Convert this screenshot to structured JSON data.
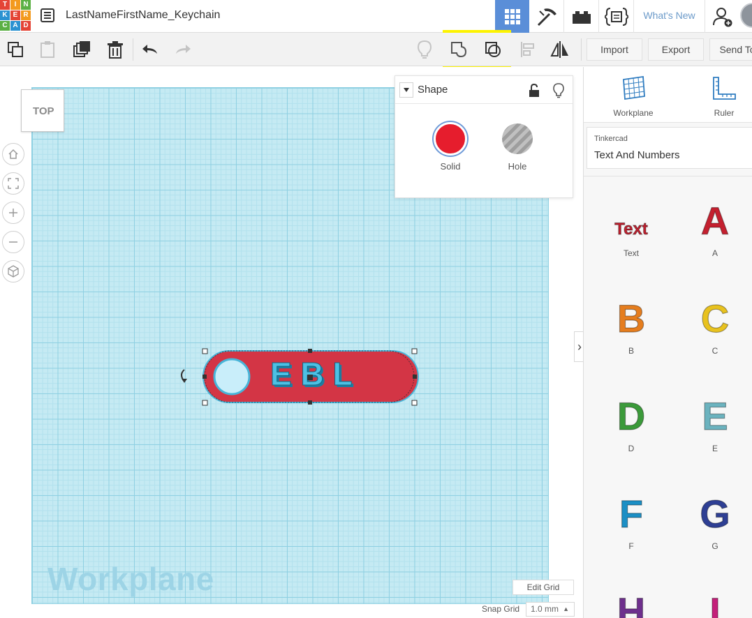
{
  "app": {
    "document_title": "LastNameFirstName_Keychain"
  },
  "logo": {
    "letters": [
      "T",
      "I",
      "N",
      "K",
      "E",
      "R",
      "C",
      "A",
      "D"
    ],
    "colors": [
      "#e44436",
      "#f39a1d",
      "#5bb044",
      "#2b92d1",
      "#e44436",
      "#f39a1d",
      "#5bb044",
      "#2b92d1",
      "#e44436"
    ]
  },
  "topbar": {
    "whats_new": "What's New",
    "active_view_color": "#5a8ed8"
  },
  "toolbar": {
    "import_label": "Import",
    "export_label": "Export",
    "send_to_label": "Send To",
    "highlight_color": "#fdf300"
  },
  "viewcube": {
    "label": "TOP"
  },
  "workplane": {
    "label": "Workplane"
  },
  "shape_panel": {
    "title": "Shape",
    "solid_label": "Solid",
    "hole_label": "Hole",
    "solid_color": "#e61d2d"
  },
  "keychain": {
    "text": "E B L",
    "color": "#d33545"
  },
  "grid_controls": {
    "edit_grid_label": "Edit Grid",
    "snap_grid_label": "Snap Grid",
    "snap_grid_value": "1.0 mm"
  },
  "right_panel": {
    "workplane_label": "Workplane",
    "ruler_label": "Ruler",
    "library_category": "Tinkercad",
    "library_name": "Text And Numbers",
    "shapes": [
      {
        "label": "Text",
        "color": "#c4202f"
      },
      {
        "label": "A",
        "color": "#c4202f"
      },
      {
        "label": "B",
        "color": "#e57d1e"
      },
      {
        "label": "C",
        "color": "#e8c21f"
      },
      {
        "label": "D",
        "color": "#3b9a3a"
      },
      {
        "label": "E",
        "color": "#6bb3bf"
      },
      {
        "label": "F",
        "color": "#1c8fc5"
      },
      {
        "label": "G",
        "color": "#2e3f94"
      },
      {
        "label": "H",
        "color": "#6e2f8d"
      },
      {
        "label": "I",
        "color": "#c4207a"
      }
    ]
  }
}
